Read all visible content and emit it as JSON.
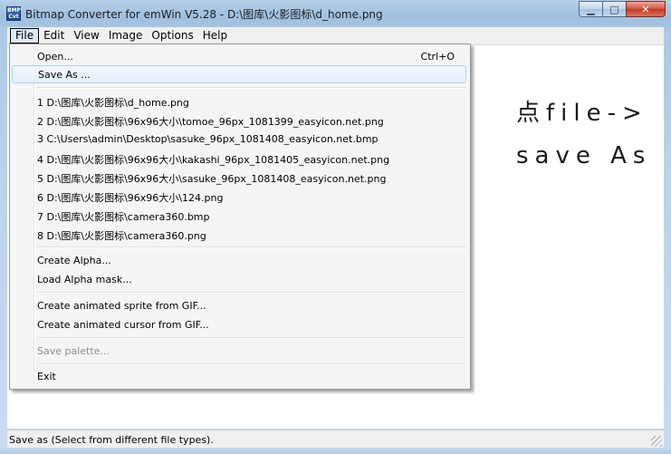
{
  "window": {
    "title": "Bitmap Converter for emWin V5.28 - D:\\图库\\火影图标\\d_home.png",
    "icon_text": [
      "BMP",
      "Cvt"
    ],
    "minimize_glyph": "▁",
    "maximize_glyph": "□",
    "close_glyph": "✕"
  },
  "menubar": {
    "items": [
      "File",
      "Edit",
      "View",
      "Image",
      "Options",
      "Help"
    ]
  },
  "file_menu": {
    "open": {
      "label": "Open...",
      "shortcut": "Ctrl+O"
    },
    "save_as": {
      "label": "Save As ..."
    },
    "recent": [
      "1 D:\\图库\\火影图标\\d_home.png",
      "2 D:\\图库\\火影图标\\96x96大小\\tomoe_96px_1081399_easyicon.net.png",
      "3 C:\\Users\\admin\\Desktop\\sasuke_96px_1081408_easyicon.net.bmp",
      "4 D:\\图库\\火影图标\\96x96大小\\kakashi_96px_1081405_easyicon.net.png",
      "5 D:\\图库\\火影图标\\96x96大小\\sasuke_96px_1081408_easyicon.net.png",
      "6 D:\\图库\\火影图标\\96x96大小\\124.png",
      "7 D:\\图库\\火影图标\\camera360.bmp",
      "8 D:\\图库\\火影图标\\camera360.png"
    ],
    "create_alpha": "Create Alpha...",
    "load_alpha_mask": "Load Alpha mask...",
    "create_sprite": "Create animated sprite from GIF...",
    "create_cursor": "Create animated cursor from GIF...",
    "save_palette": "Save palette...",
    "exit": "Exit"
  },
  "annotation": {
    "line1": "点file->",
    "line2": "save As"
  },
  "statusbar": {
    "text": "Save as (Select from different file types)."
  },
  "colors": {
    "title_bar": "#a7c4e1",
    "close_button": "#c23a22",
    "menu_highlight": "#e4eefb"
  }
}
